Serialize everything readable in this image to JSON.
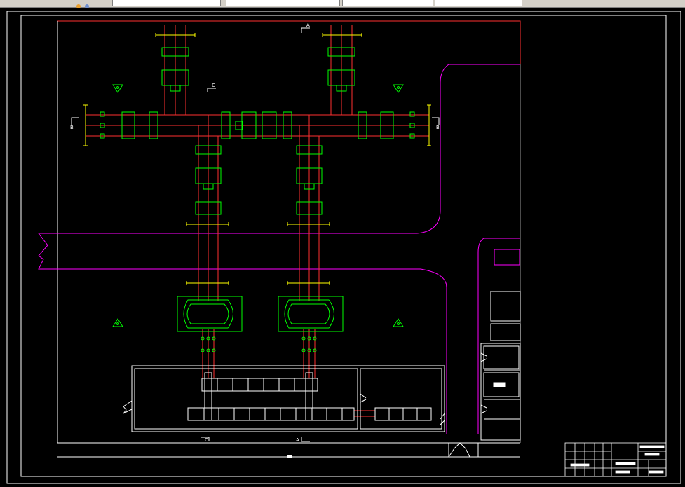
{
  "toolbar": {
    "fields": [
      "",
      "",
      "",
      "",
      ""
    ]
  },
  "drawing": {
    "section_markers": {
      "a_top": "A",
      "a_bottom": "A",
      "b_left": "B",
      "b_right": "B",
      "c_top": "C",
      "c_bottom": "C"
    },
    "rooms": {
      "main_room": "",
      "right_room": "",
      "side_top": "",
      "side_mid": "",
      "side_stair": "",
      "side_room1": "",
      "side_room2": "",
      "side_room3": "",
      "side_room4": ""
    },
    "title_block": {
      "rows": [
        "",
        "",
        "",
        ""
      ]
    }
  },
  "colors": {
    "background": "#000000",
    "frame": "#ffffff",
    "pipe": "#ff3030",
    "equipment": "#00ff00",
    "road": "#ff00ff",
    "dimension": "#ffff00"
  }
}
